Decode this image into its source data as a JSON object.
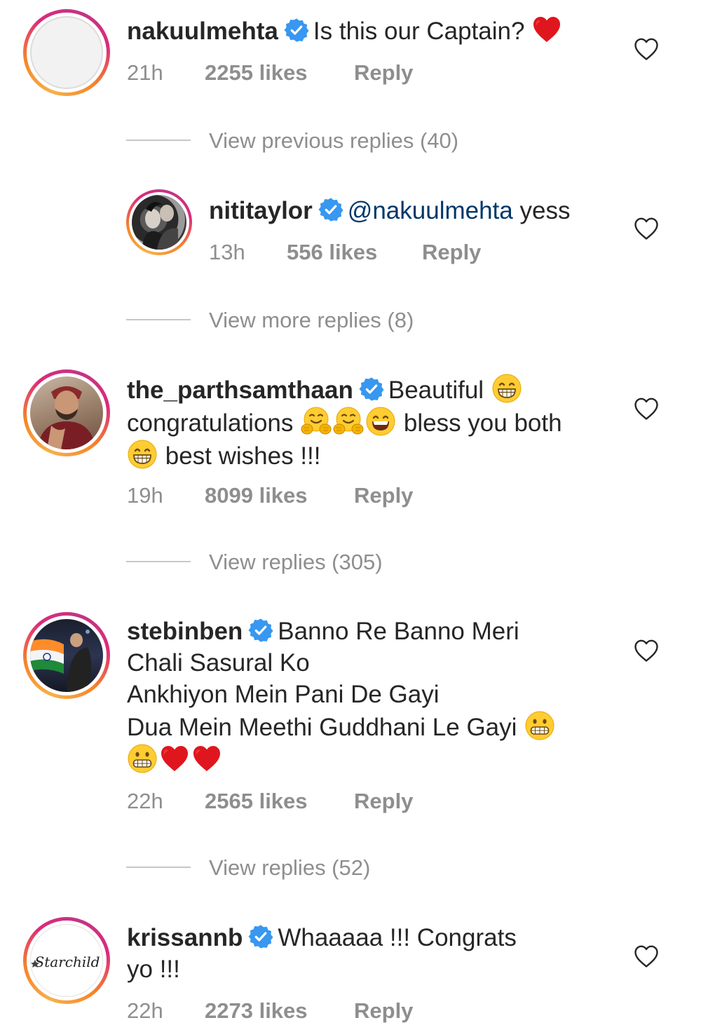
{
  "comments": [
    {
      "username": "nakuulmehta",
      "text": "Is this our Captain?",
      "time": "21h",
      "likes": "2255 likes",
      "reply": "Reply"
    },
    {
      "username": "nititaylor",
      "mention": "@nakuulmehta",
      "text": "yess",
      "time": "13h",
      "likes": "556 likes",
      "reply": "Reply"
    },
    {
      "username": "the_parthsamthaan",
      "text_1": "Beautiful",
      "text_2": "congratulations",
      "text_3": "bless you both",
      "text_4": "best wishes !!!",
      "time": "19h",
      "likes": "8099 likes",
      "reply": "Reply"
    },
    {
      "username": "stebinben",
      "text_1": "Banno Re Banno Meri",
      "text_2": "Chali Sasural Ko",
      "text_3": "Ankhiyon Mein Pani De Gayi",
      "text_4": "Dua Mein Meethi Guddhani Le Gayi",
      "time": "22h",
      "likes": "2565 likes",
      "reply": "Reply"
    },
    {
      "username": "krissannb",
      "text_1": "Whaaaaa !!! Congrats",
      "text_2": "yo !!!",
      "time": "22h",
      "likes": "2273 likes",
      "reply": "Reply",
      "avatar_text": "Starchild"
    }
  ],
  "view_replies": [
    "View previous replies (40)",
    "View more replies (8)",
    "View replies (305)",
    "View replies (52)"
  ],
  "icons": {
    "verified_badge": "verified-badge-icon",
    "like": "heart-outline-icon",
    "red_heart": "red-heart-emoji",
    "grin": "grinning-face-emoji",
    "hug": "hugging-face-emoji",
    "grimace": "grimacing-face-emoji"
  },
  "colors": {
    "verified": "#3897f0",
    "muted_text": "#8e8e8e",
    "mention": "#00376b",
    "heart_emoji": "#e0161e"
  }
}
